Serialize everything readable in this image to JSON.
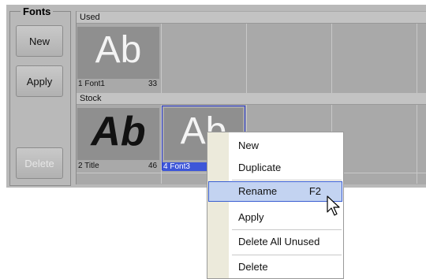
{
  "group": {
    "title": "Fonts"
  },
  "buttons": {
    "new": "New",
    "apply": "Apply",
    "delete": "Delete"
  },
  "sections": {
    "used": "Used",
    "stock": "Stock"
  },
  "used_fonts": [
    {
      "glyph": "Ab",
      "label": "1 Font1",
      "count": "33"
    }
  ],
  "stock_fonts": [
    {
      "glyph": "Ab",
      "label": "2 Title",
      "count": "46"
    },
    {
      "glyph": "Ab",
      "label": "4 Font3",
      "count": ""
    }
  ],
  "context_menu": {
    "items": [
      {
        "label": "New",
        "shortcut": ""
      },
      {
        "label": "Duplicate",
        "shortcut": ""
      },
      {
        "label": "Rename",
        "shortcut": "F2",
        "highlighted": true
      },
      {
        "label": "Apply",
        "shortcut": ""
      },
      {
        "label": "Delete All Unused",
        "shortcut": ""
      },
      {
        "label": "Delete",
        "shortcut": ""
      }
    ]
  }
}
